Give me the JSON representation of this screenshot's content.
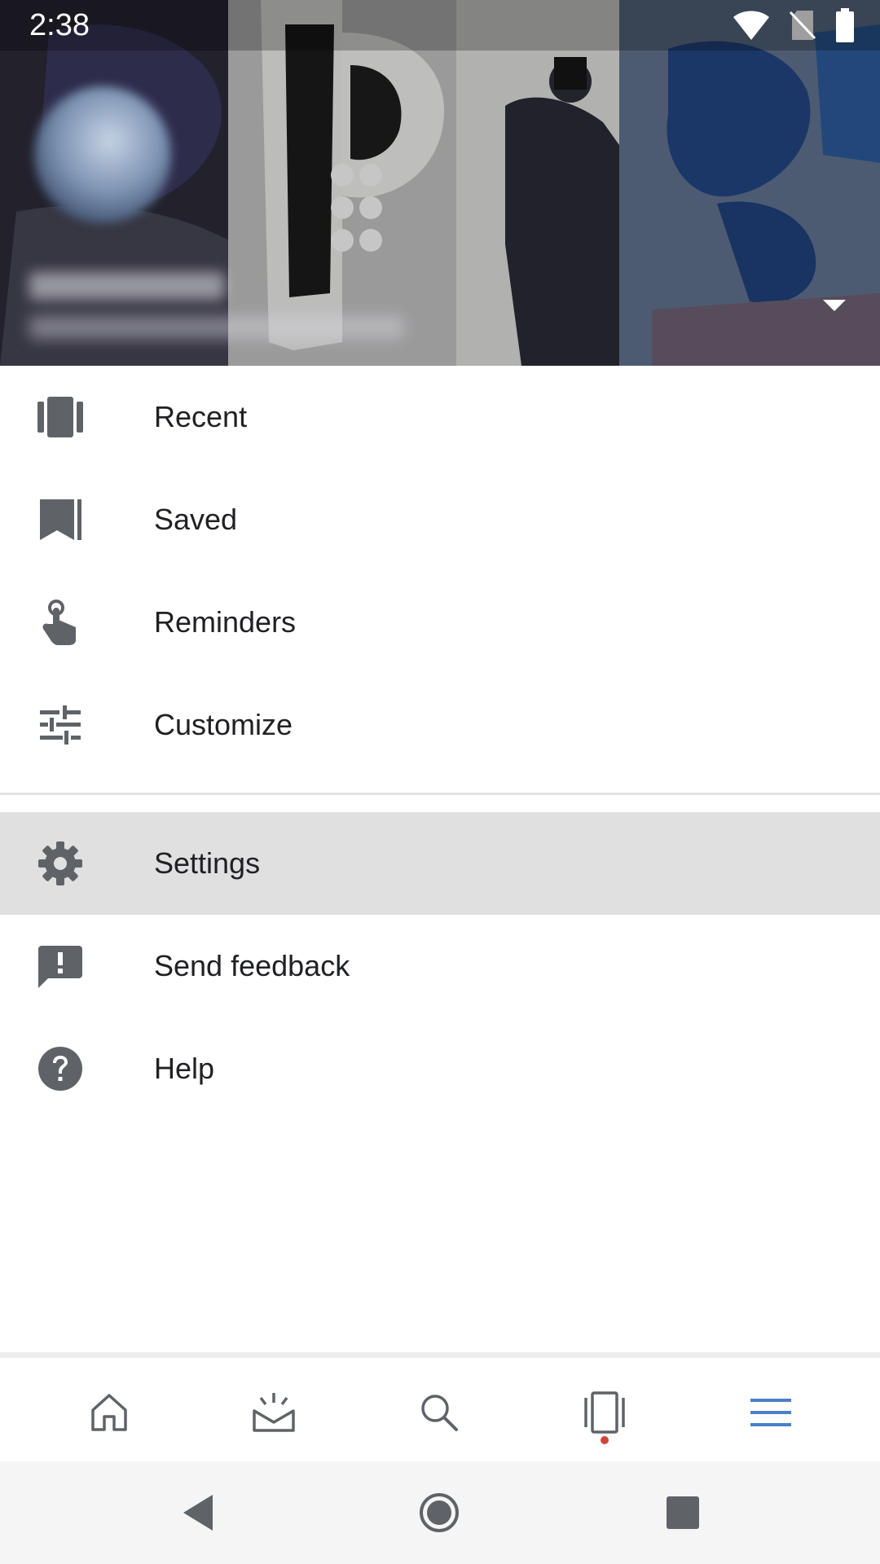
{
  "status_bar": {
    "time": "2:38",
    "icons": [
      "wifi-icon",
      "no-sim-icon",
      "battery-icon"
    ]
  },
  "header": {
    "avatar": "avatar",
    "account_name": "",
    "account_email": "",
    "dropdown_icon": "triangle-down-icon"
  },
  "menu": {
    "items": [
      {
        "label": "Recent",
        "icon": "recent-icon"
      },
      {
        "label": "Saved",
        "icon": "bookmark-icon"
      },
      {
        "label": "Reminders",
        "icon": "reminder-hand-icon"
      },
      {
        "label": "Customize",
        "icon": "tune-icon"
      }
    ],
    "secondary": [
      {
        "label": "Settings",
        "icon": "gear-icon",
        "selected": true
      },
      {
        "label": "Send feedback",
        "icon": "feedback-icon"
      },
      {
        "label": "Help",
        "icon": "help-icon"
      }
    ]
  },
  "bottom_nav": {
    "items": [
      "home-icon",
      "updates-icon",
      "search-icon",
      "collections-icon",
      "menu-icon"
    ],
    "active": "menu-icon",
    "accent_color": "#4a80c9",
    "inactive_color": "#5f6368",
    "badge_color": "#d0453b"
  },
  "system_nav": {
    "items": [
      "back-icon",
      "home-circle-icon",
      "recents-square-icon"
    ]
  },
  "colors": {
    "icon_gray": "#5f6368",
    "text": "#202124",
    "selected_bg": "#e0e0e0"
  }
}
